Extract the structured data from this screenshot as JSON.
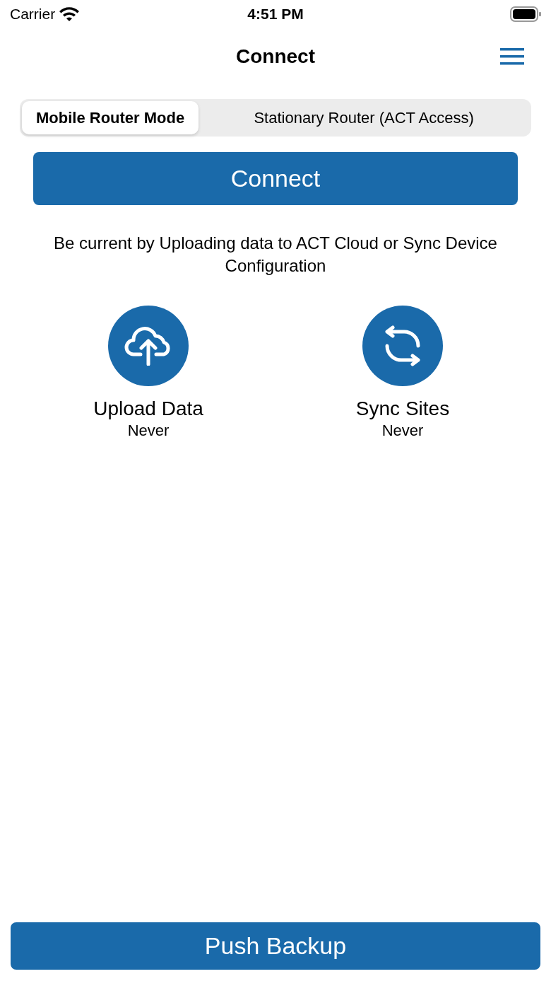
{
  "status_bar": {
    "carrier": "Carrier",
    "time": "4:51 PM"
  },
  "nav": {
    "title": "Connect"
  },
  "mode_tabs": [
    {
      "label": "Mobile Router Mode",
      "selected": true
    },
    {
      "label": "Stationary Router (ACT Access)",
      "selected": false
    }
  ],
  "connect_button": "Connect",
  "description": "Be current by Uploading data to ACT Cloud or Sync Device Configuration",
  "actions": [
    {
      "kind": "upload",
      "label": "Upload Data",
      "last": "Never"
    },
    {
      "kind": "sync",
      "label": "Sync Sites",
      "last": "Never"
    }
  ],
  "push_button": "Push Backup"
}
